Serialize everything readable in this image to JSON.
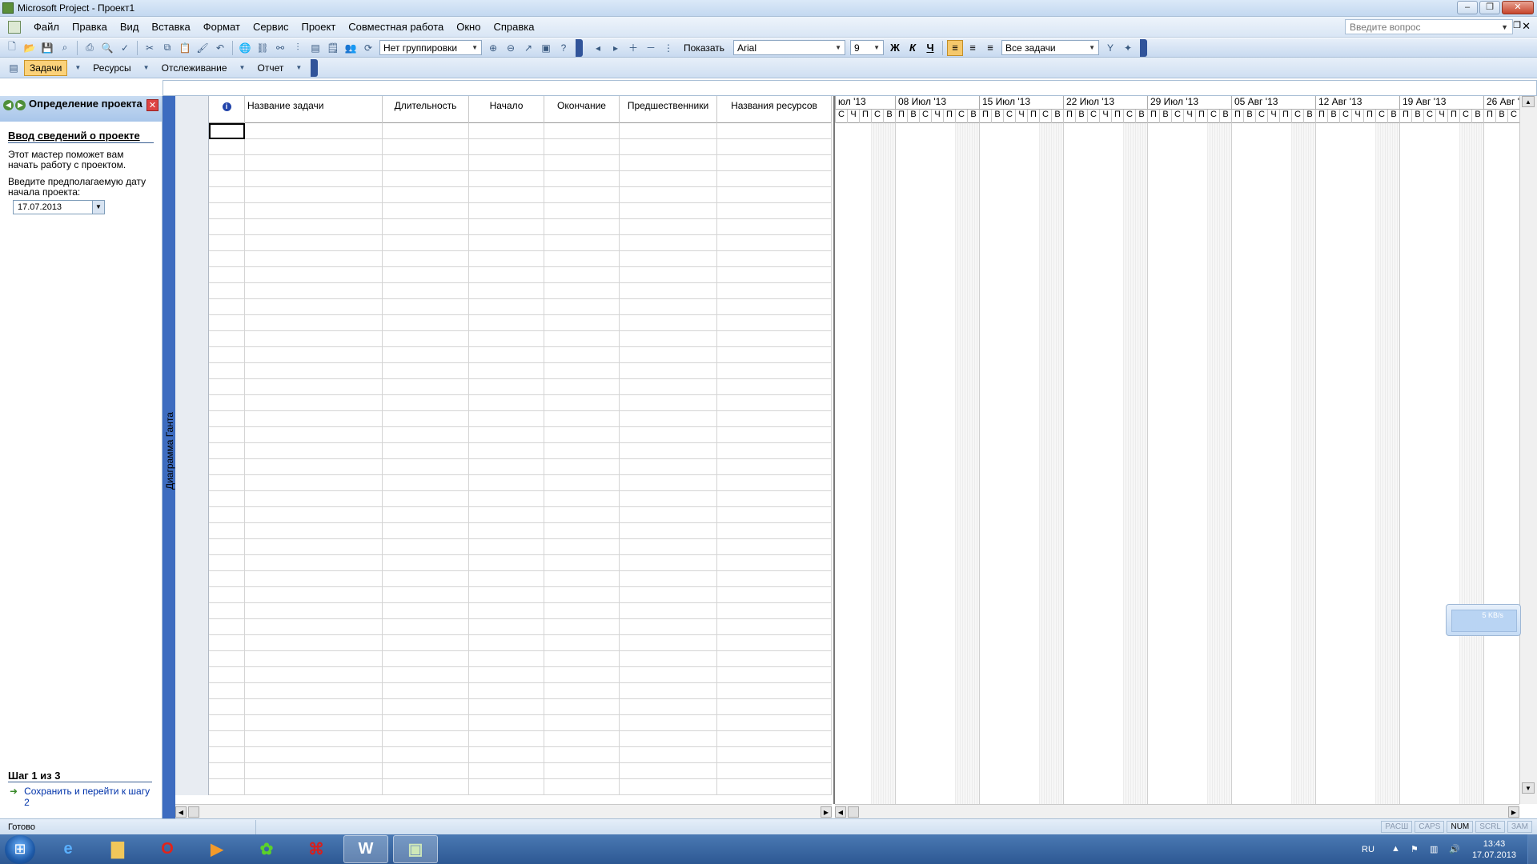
{
  "window": {
    "title": "Microsoft Project - Проект1"
  },
  "menu": {
    "items": [
      "Файл",
      "Правка",
      "Вид",
      "Вставка",
      "Формат",
      "Сервис",
      "Проект",
      "Совместная работа",
      "Окно",
      "Справка"
    ],
    "help_placeholder": "Введите вопрос"
  },
  "toolbar": {
    "grouping": "Нет группировки",
    "show_label": "Показать",
    "font": "Arial",
    "font_size": "9",
    "bold": "Ж",
    "italic": "К",
    "underline": "Ч",
    "filter": "Все задачи"
  },
  "viewtabs": {
    "tasks": "Задачи",
    "resources": "Ресурсы",
    "tracking": "Отслеживание",
    "report": "Отчет"
  },
  "taskpane": {
    "title": "Определение проекта",
    "heading": "Ввод сведений о проекте",
    "intro": "Этот мастер поможет вам начать работу с проектом.",
    "prompt": "Введите предполагаемую дату начала проекта:",
    "start_date": "17.07.2013",
    "step": "Шаг 1 из 3",
    "next_link": "Сохранить и перейти к шагу 2"
  },
  "view_name": "Диаграмма Ганта",
  "grid": {
    "columns": [
      "",
      "Название задачи",
      "Длительность",
      "Начало",
      "Окончание",
      "Предшественники",
      "Названия ресурсов"
    ]
  },
  "gantt": {
    "weeks": [
      "юл '13",
      "08 Июл '13",
      "15 Июл '13",
      "22 Июл '13",
      "29 Июл '13",
      "05 Авг '13",
      "12 Авг '13",
      "19 Авг '13",
      "26 Авг '1"
    ],
    "first_partial_days": [
      "С",
      "Ч",
      "П",
      "С",
      "В"
    ],
    "week_days": [
      "П",
      "В",
      "С",
      "Ч",
      "П",
      "С",
      "В"
    ]
  },
  "status": {
    "ready": "Готово",
    "indicators": [
      "РАСШ",
      "CAPS",
      "NUM",
      "SCRL",
      "ЗАМ"
    ],
    "active_indicator": "NUM"
  },
  "net_widget": {
    "speed": "5 KB/s"
  },
  "taskbar": {
    "lang": "RU",
    "time": "13:43",
    "date": "17.07.2013"
  }
}
